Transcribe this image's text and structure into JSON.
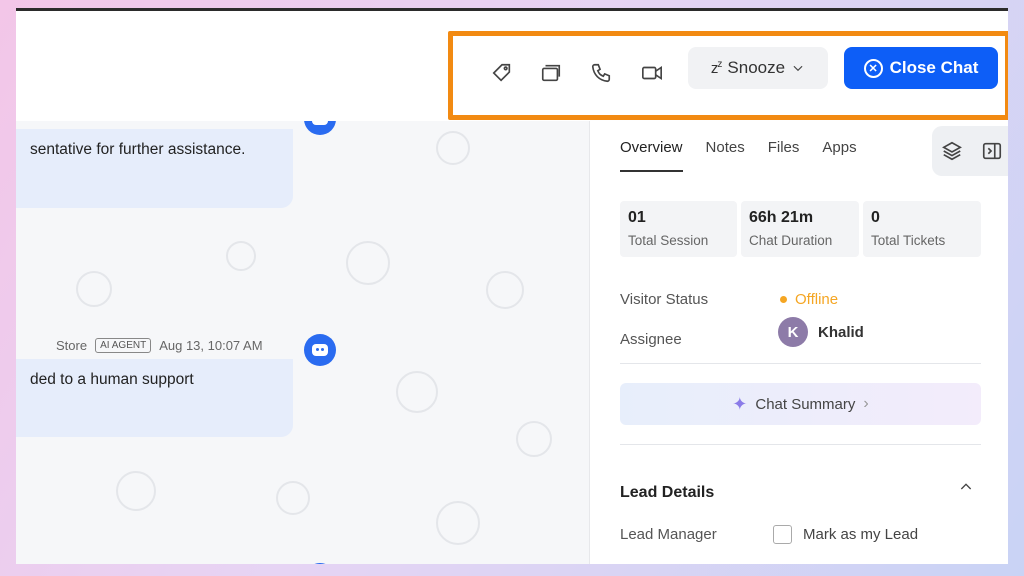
{
  "header": {
    "snooze_label": "Snooze",
    "snooze_icon": "zᶻ",
    "close_label": "Close Chat",
    "icons": [
      "tag-icon",
      "window-icon",
      "phone-icon",
      "video-icon"
    ]
  },
  "chat": {
    "messages": [
      {
        "text": "sentative for further assistance."
      },
      {
        "text": "ded to a human support"
      }
    ],
    "meta": {
      "sender": "Store",
      "badge": "AI AGENT",
      "time": "Aug 13, 10:07 AM"
    }
  },
  "panel": {
    "tabs": [
      {
        "label": "Overview",
        "active": true
      },
      {
        "label": "Notes"
      },
      {
        "label": "Files"
      },
      {
        "label": "Apps"
      }
    ],
    "stats": [
      {
        "value": "01",
        "label": "Total Session"
      },
      {
        "value": "66h 21m",
        "label": "Chat Duration"
      },
      {
        "value": "0",
        "label": "Total Tickets"
      }
    ],
    "visitor_status_label": "Visitor Status",
    "visitor_status_value": "Offline",
    "assignee_label": "Assignee",
    "assignee_initial": "K",
    "assignee_name": "Khalid",
    "summary_label": "Chat Summary",
    "lead_details_title": "Lead Details",
    "lead_manager_label": "Lead Manager",
    "mark_lead_label": "Mark as my Lead"
  },
  "colors": {
    "accent_blue": "#0d5ef7",
    "highlight_orange": "#f28a12",
    "offline_orange": "#f5a623"
  }
}
